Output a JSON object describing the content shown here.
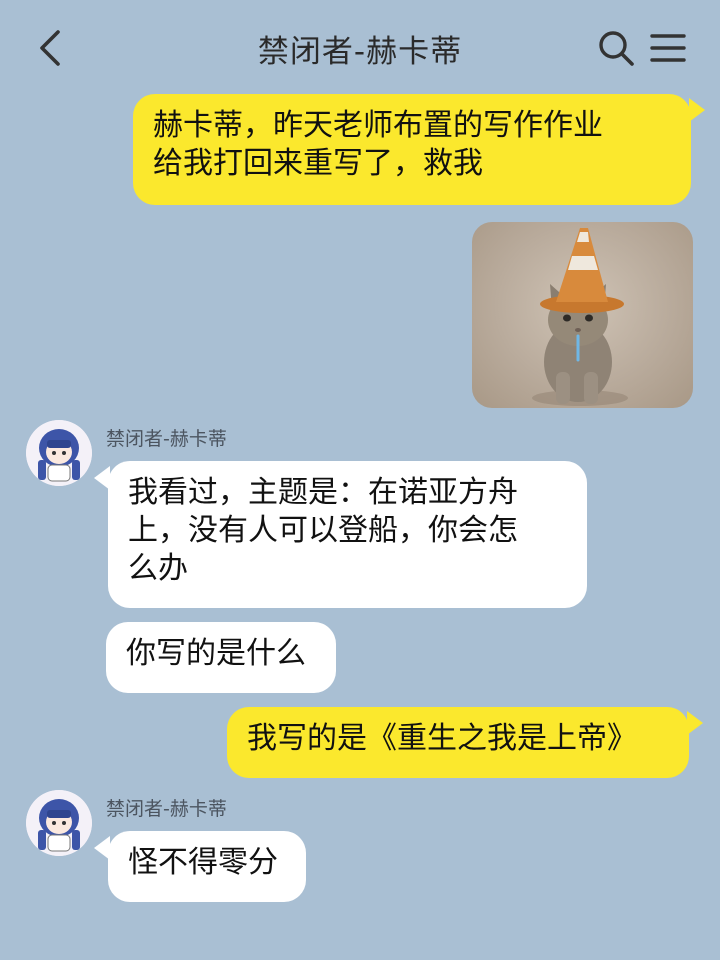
{
  "header": {
    "title": "禁闭者-赫卡蒂",
    "back_icon": "chevron-left-icon",
    "search_icon": "search-icon",
    "menu_icon": "menu-icon"
  },
  "messages": [
    {
      "from": "me",
      "text": "赫卡蒂，昨天老师布置的写作作业\n给我打回来重写了，救我"
    },
    {
      "from": "me",
      "type": "image",
      "description": "cat-with-traffic-cone-hat"
    },
    {
      "from": "other",
      "sender": "禁闭者-赫卡蒂",
      "text": "我看过，主题是：在诺亚方舟\n上，没有人可以登船，你会怎\n么办"
    },
    {
      "from": "other",
      "text": "你写的是什么"
    },
    {
      "from": "me",
      "text": "我写的是《重生之我是上帝》"
    },
    {
      "from": "other",
      "sender": "禁闭者-赫卡蒂",
      "text": "怪不得零分"
    }
  ],
  "colors": {
    "background": "#a9bfd3",
    "my_bubble": "#fbe82d",
    "their_bubble": "#ffffff"
  }
}
